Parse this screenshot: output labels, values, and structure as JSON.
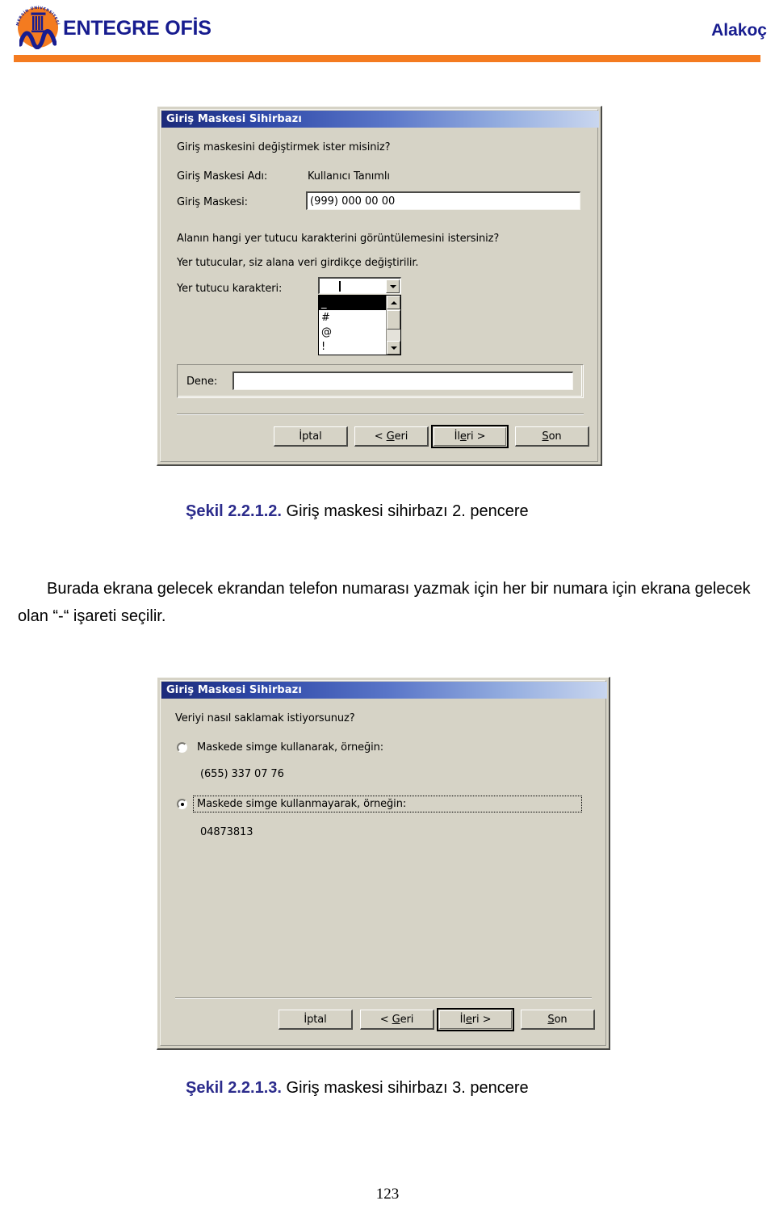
{
  "header": {
    "brand_title": "ENTEGRE OFİS",
    "author": "Alakoç",
    "logo_ring_text": "MERSİN ÜNİVERSİTESİ 1992",
    "accent_color": "#F47B20",
    "brand_color": "#171C8F"
  },
  "dialog1": {
    "title": "Giriş Maskesi Sihirbazı",
    "prompt": "Giriş maskesini değiştirmek ister misiniz?",
    "mask_name_label": "Giriş Maskesi Adı:",
    "mask_name_value": "Kullanıcı Tanımlı",
    "mask_label": "Giriş Maskesi:",
    "mask_value": "(999) 000 00 00",
    "placeholder_question": "Alanın hangi yer tutucu karakterini görüntülemesini  istersiniz?",
    "placeholder_note": "Yer tutucular, siz alana veri girdikçe değiştirilir.",
    "placeholder_label": "Yer tutucu karakteri:",
    "placeholder_combo_value": "",
    "placeholder_options": [
      "_",
      "#",
      "@",
      "!"
    ],
    "placeholder_selected_index": 0,
    "try_label": "Dene:",
    "try_value": "",
    "buttons": {
      "cancel": "İptal",
      "back_pre": "< ",
      "back_accel": "G",
      "back_post": "eri",
      "next_pre": "İl",
      "next_accel": "e",
      "next_post": "ri >",
      "finish_accel": "S",
      "finish_post": "on"
    }
  },
  "caption1": {
    "number": "Şekil 2.2.1.2.",
    "text": " Giriş maskesi sihirbazı 2. pencere"
  },
  "paragraph": "Burada ekrana gelecek ekrandan telefon numarası yazmak için her bir numara için ekrana gelecek olan “-“ işareti seçilir.",
  "dialog2": {
    "title": "Giriş Maskesi Sihirbazı",
    "prompt": "Veriyi nasıl saklamak istiyorsunuz?",
    "option1_label": "Maskede simge kullanarak, örneğin:",
    "option1_example": "(655) 337 07 76",
    "option2_label": "Maskede simge kullanmayarak, örneğin:",
    "option2_example": "04873813",
    "selected_option": 2,
    "buttons": {
      "cancel": "İptal",
      "back_pre": "< ",
      "back_accel": "G",
      "back_post": "eri",
      "next_pre": "İl",
      "next_accel": "e",
      "next_post": "ri >",
      "finish_accel": "S",
      "finish_post": "on"
    }
  },
  "caption2": {
    "number": "Şekil 2.2.1.3.",
    "text": " Giriş maskesi sihirbazı 3. pencere"
  },
  "page_number": "123"
}
